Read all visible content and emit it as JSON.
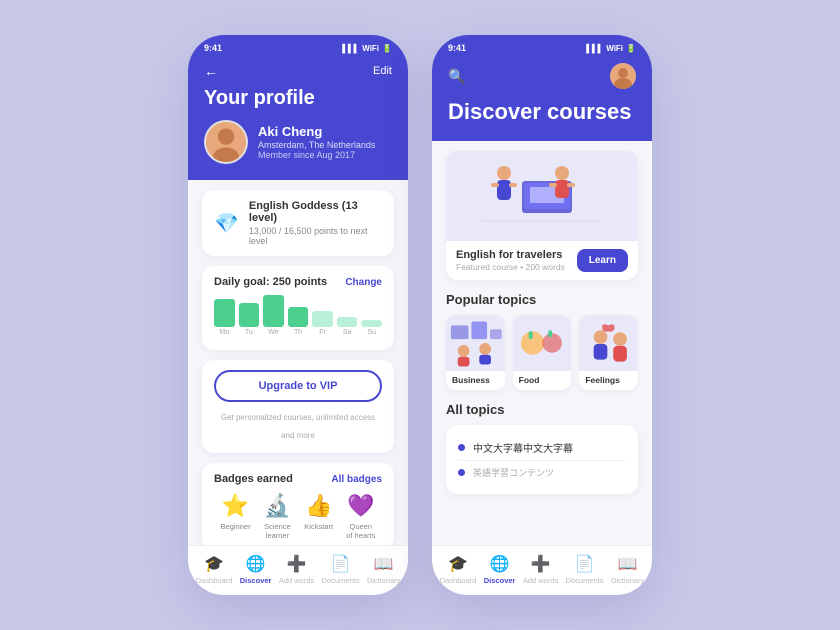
{
  "app": {
    "status_time": "9:41",
    "status_signal": "▌▌▌",
    "status_wifi": "WiFi",
    "status_battery": "▮▮▮"
  },
  "left": {
    "back": "←",
    "edit": "Edit",
    "title": "Your profile",
    "user": {
      "name": "Aki Cheng",
      "location": "Amsterdam, The Netherlands",
      "member": "Member since Aug 2017"
    },
    "badge": {
      "title": "English Goddess (13 level)",
      "sub": "13,000 / 16,500 points to next level"
    },
    "daily_goal": {
      "title": "Daily goal: 250 points",
      "change": "Change"
    },
    "week_days": [
      "Mo",
      "Tu",
      "We",
      "Th",
      "Fr",
      "Sa",
      "Su"
    ],
    "week_values": [
      80,
      70,
      90,
      60,
      50,
      30,
      20
    ],
    "vip": {
      "btn": "Upgrade to VIP",
      "sub": "Get personalized courses, unlimited access and more"
    },
    "badges": {
      "title": "Badges earned",
      "all": "All badges",
      "items": [
        {
          "emoji": "⭐",
          "name": "Beginner"
        },
        {
          "emoji": "🔬",
          "name": "Science\nlearner"
        },
        {
          "emoji": "👍",
          "name": "Kickstart"
        },
        {
          "emoji": "💜",
          "name": "Queen\nof hearts"
        }
      ]
    },
    "nav": [
      {
        "icon": "🎓",
        "label": "Dashboard",
        "active": false
      },
      {
        "icon": "🌐",
        "label": "Discover",
        "active": true
      },
      {
        "icon": "➕",
        "label": "Add words",
        "active": false
      },
      {
        "icon": "📄",
        "label": "Documents",
        "active": false
      },
      {
        "icon": "📖",
        "label": "Dictionary",
        "active": false
      }
    ]
  },
  "right": {
    "title": "Discover courses",
    "featured": {
      "title": "English for travelers",
      "sub": "Featured course • 200 words",
      "btn": "Learn"
    },
    "popular": {
      "title": "Popular topics",
      "items": [
        "Business",
        "Food",
        "Feelings"
      ]
    },
    "all_topics": {
      "title": "All topics",
      "items": [
        {
          "text": "中文大字幕中文大字幕"
        },
        {
          "text": "英語学習コンテンツ"
        }
      ]
    },
    "nav": [
      {
        "icon": "🎓",
        "label": "Dashboard",
        "active": false
      },
      {
        "icon": "🌐",
        "label": "Discover",
        "active": true
      },
      {
        "icon": "➕",
        "label": "Add words",
        "active": false
      },
      {
        "icon": "📄",
        "label": "Documents",
        "active": false
      },
      {
        "icon": "📖",
        "label": "Dictionary",
        "active": false
      }
    ]
  }
}
